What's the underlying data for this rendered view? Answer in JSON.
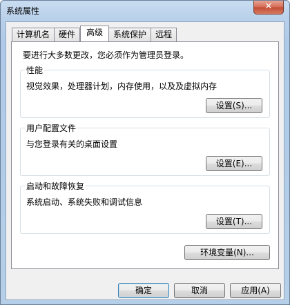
{
  "window": {
    "title": "系统属性",
    "close_label": "✕"
  },
  "tabs": [
    {
      "label": "计算机名"
    },
    {
      "label": "硬件"
    },
    {
      "label": "高级"
    },
    {
      "label": "系统保护"
    },
    {
      "label": "远程"
    }
  ],
  "active_tab": "高级",
  "panel": {
    "notice": "要进行大多数更改，您必须作为管理员登录。",
    "performance": {
      "title": "性能",
      "description": "视觉效果，处理器计划，内存使用，以及及虚拟内存",
      "settings_label": "设置(S)..."
    },
    "user_profiles": {
      "title": "用户配置文件",
      "description": "与您登录有关的桌面设置",
      "settings_label": "设置(E)..."
    },
    "startup_recovery": {
      "title": "启动和故障恢复",
      "description": "系统启动、系统失败和调试信息",
      "settings_label": "设置(T)..."
    },
    "env_vars_label": "环境变量(N)..."
  },
  "footer": {
    "ok_label": "确定",
    "cancel_label": "取消",
    "apply_label": "应用(A)"
  }
}
